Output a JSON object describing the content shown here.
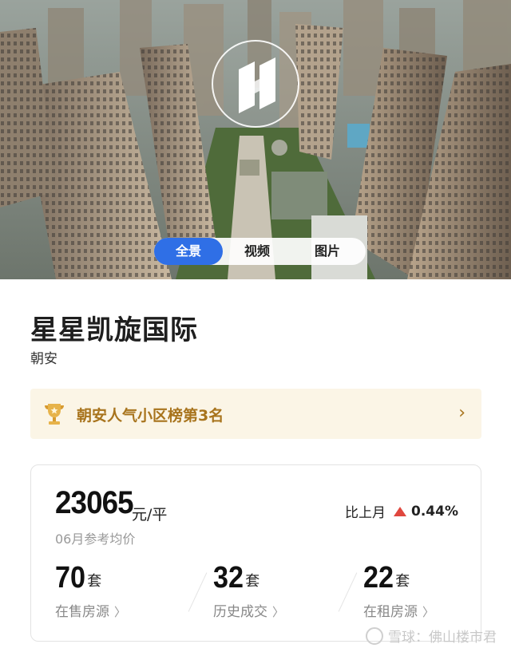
{
  "hero": {
    "tabs": [
      {
        "label": "全景",
        "active": true
      },
      {
        "label": "视频",
        "active": false
      },
      {
        "label": "图片",
        "active": false
      }
    ]
  },
  "community": {
    "name": "星星凯旋国际",
    "district": "朝安"
  },
  "ranking": {
    "text": "朝安人气小区榜第3名",
    "chevron": "›",
    "icon": "trophy-icon",
    "color": "#a8741d",
    "background": "#fbf5e6"
  },
  "price": {
    "value": "23065",
    "unit": "元/平",
    "caption": "06月参考均价",
    "compare_label": "比上月",
    "change": "0.44%",
    "trend": "up",
    "trend_color": "#e0473e"
  },
  "stats": [
    {
      "value": "70",
      "unit": "套",
      "label": "在售房源",
      "chevron": "〉"
    },
    {
      "value": "32",
      "unit": "套",
      "label": "历史成交",
      "chevron": "〉"
    },
    {
      "value": "22",
      "unit": "套",
      "label": "在租房源",
      "chevron": "〉"
    }
  ],
  "watermark": {
    "text": "雪球：佛山楼市君",
    "icon": "snowball-icon"
  },
  "colors": {
    "accent": "#2f6fe6"
  }
}
